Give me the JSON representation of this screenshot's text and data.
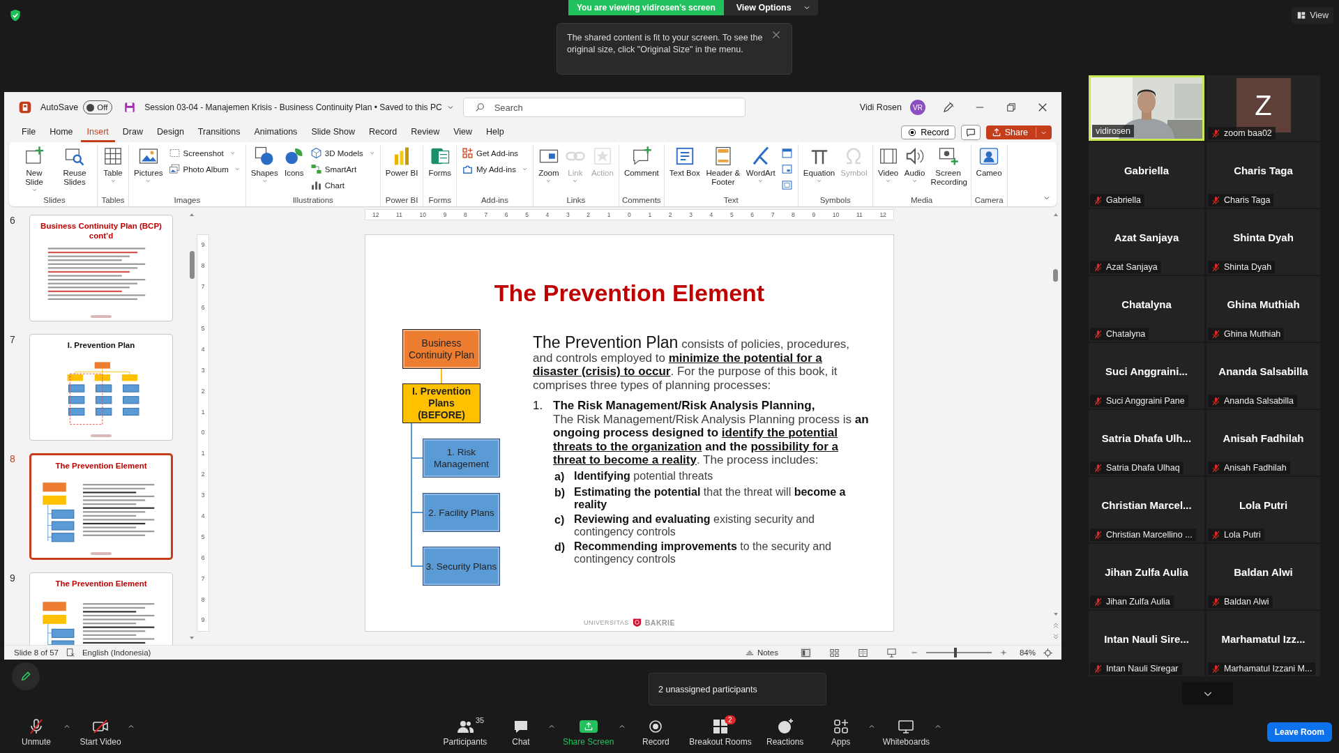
{
  "zoom_top": {
    "banner": "You are viewing vidirosen's screen",
    "view_options": "View Options",
    "notice": "The shared content is fit to your screen. To see the original size, click \"Original Size\" in the menu.",
    "view_button": "View"
  },
  "powerpoint": {
    "title_bar": {
      "autosave_label": "AutoSave",
      "autosave_on": false,
      "autosave_state": "Off",
      "document_title": "Session 03-04 - Manajemen Krisis - Business Continuity Plan • Saved to this PC",
      "search": {
        "placeholder": "Search"
      },
      "user_name": "Vidi Rosen",
      "user_initials": "VR"
    },
    "menu_tabs": [
      {
        "label": "File",
        "selected": false
      },
      {
        "label": "Home",
        "selected": false
      },
      {
        "label": "Insert",
        "selected": true
      },
      {
        "label": "Draw",
        "selected": false
      },
      {
        "label": "Design",
        "selected": false
      },
      {
        "label": "Transitions",
        "selected": false
      },
      {
        "label": "Animations",
        "selected": false
      },
      {
        "label": "Slide Show",
        "selected": false
      },
      {
        "label": "Record",
        "selected": false
      },
      {
        "label": "Review",
        "selected": false
      },
      {
        "label": "View",
        "selected": false
      },
      {
        "label": "Help",
        "selected": false
      }
    ],
    "record_button": "Record",
    "share_button": "Share",
    "ribbon_groups": [
      {
        "label": "Slides",
        "items": [
          {
            "kind": "large",
            "label": "New Slide",
            "dropdown": true,
            "disabled": false
          },
          {
            "kind": "large",
            "label": "Reuse Slides",
            "dropdown": false,
            "disabled": false
          }
        ]
      },
      {
        "label": "Tables",
        "items": [
          {
            "kind": "large",
            "label": "Table",
            "dropdown": true,
            "disabled": false
          }
        ]
      },
      {
        "label": "Images",
        "items": [
          {
            "kind": "large",
            "label": "Pictures",
            "dropdown": true,
            "disabled": false
          },
          {
            "kind": "small",
            "label": "Screenshot",
            "dropdown": true,
            "disabled": false
          },
          {
            "kind": "small",
            "label": "Photo Album",
            "dropdown": true,
            "disabled": false
          }
        ]
      },
      {
        "label": "Illustrations",
        "items": [
          {
            "kind": "large",
            "label": "Shapes",
            "dropdown": true,
            "disabled": false
          },
          {
            "kind": "large",
            "label": "Icons",
            "dropdown": false,
            "disabled": false
          },
          {
            "kind": "small",
            "label": "3D Models",
            "dropdown": true,
            "disabled": false
          },
          {
            "kind": "small",
            "label": "SmartArt",
            "dropdown": false,
            "disabled": false
          },
          {
            "kind": "small",
            "label": "Chart",
            "dropdown": false,
            "disabled": false
          }
        ]
      },
      {
        "label": "Power BI",
        "items": [
          {
            "kind": "large",
            "label": "Power BI",
            "dropdown": false,
            "disabled": false
          }
        ]
      },
      {
        "label": "Forms",
        "items": [
          {
            "kind": "large",
            "label": "Forms",
            "dropdown": false,
            "disabled": false
          }
        ]
      },
      {
        "label": "Add-ins",
        "items": [
          {
            "kind": "small",
            "label": "Get Add-ins",
            "dropdown": false,
            "disabled": false
          },
          {
            "kind": "small",
            "label": "My Add-ins",
            "dropdown": true,
            "disabled": false
          }
        ]
      },
      {
        "label": "Links",
        "items": [
          {
            "kind": "large",
            "label": "Zoom",
            "dropdown": true,
            "disabled": false
          },
          {
            "kind": "large",
            "label": "Link",
            "dropdown": true,
            "disabled": true
          },
          {
            "kind": "large",
            "label": "Action",
            "dropdown": false,
            "disabled": true
          }
        ]
      },
      {
        "label": "Comments",
        "items": [
          {
            "kind": "large",
            "label": "Comment",
            "dropdown": false,
            "disabled": false
          }
        ]
      },
      {
        "label": "Text",
        "items": [
          {
            "kind": "large",
            "label": "Text Box",
            "dropdown": false,
            "disabled": false
          },
          {
            "kind": "large",
            "label": "Header & Footer",
            "dropdown": false,
            "disabled": false
          },
          {
            "kind": "large",
            "label": "WordArt",
            "dropdown": true,
            "disabled": false
          },
          {
            "kind": "icon",
            "dropdown": false,
            "disabled": false
          },
          {
            "kind": "icon",
            "dropdown": false,
            "disabled": false
          },
          {
            "kind": "icon",
            "dropdown": false,
            "disabled": false
          }
        ]
      },
      {
        "label": "Symbols",
        "items": [
          {
            "kind": "large",
            "label": "Equation",
            "dropdown": true,
            "disabled": false
          },
          {
            "kind": "large",
            "label": "Symbol",
            "dropdown": false,
            "disabled": true
          }
        ]
      },
      {
        "label": "Media",
        "items": [
          {
            "kind": "large",
            "label": "Video",
            "dropdown": true,
            "disabled": false
          },
          {
            "kind": "large",
            "label": "Audio",
            "dropdown": true,
            "disabled": false
          },
          {
            "kind": "large",
            "label": "Screen Recording",
            "dropdown": false,
            "disabled": false
          }
        ]
      },
      {
        "label": "Camera",
        "items": [
          {
            "kind": "large",
            "label": "Cameo",
            "dropdown": false,
            "disabled": false
          }
        ]
      }
    ],
    "thumbnails": [
      {
        "number": "6",
        "title": "Business Continuity Plan (BCP) cont’d",
        "color": "#c00000",
        "kind": "text",
        "selected": false
      },
      {
        "number": "7",
        "title": "I. Prevention Plan",
        "color": "#111111",
        "kind": "org-chart",
        "selected": false
      },
      {
        "number": "8",
        "title": "The Prevention Element",
        "color": "#c00000",
        "kind": "diagram-text",
        "selected": true
      },
      {
        "number": "9",
        "title": "The Prevention Element",
        "color": "#c00000",
        "kind": "diagram-text",
        "selected": false
      }
    ],
    "horizontal_ruler": [
      "12",
      "11",
      "10",
      "9",
      "8",
      "7",
      "6",
      "5",
      "4",
      "3",
      "2",
      "1",
      "0",
      "1",
      "2",
      "3",
      "4",
      "5",
      "6",
      "7",
      "8",
      "9",
      "10",
      "11",
      "12"
    ],
    "vertical_ruler": [
      "9",
      "8",
      "7",
      "6",
      "5",
      "4",
      "3",
      "2",
      "1",
      "0",
      "1",
      "2",
      "3",
      "4",
      "5",
      "6",
      "7",
      "8",
      "9"
    ],
    "slide": {
      "title": "The Prevention Element",
      "diagram": [
        {
          "text": "Business Continuity Plan",
          "kind": "root"
        },
        {
          "text": "I. Prevention Plans (BEFORE)",
          "kind": "phase"
        },
        {
          "text": "1. Risk Management",
          "kind": "plan"
        },
        {
          "text": "2. Facility Plans",
          "kind": "plan"
        },
        {
          "text": "3. Security Plans",
          "kind": "plan"
        }
      ],
      "intro": [
        {
          "kind": "lead",
          "text": "The Prevention Plan"
        },
        {
          "kind": "plain",
          "text": " consists of policies, procedures, and controls employed to "
        },
        {
          "kind": "underline",
          "text": "minimize the potential for a disaster (crisis) to occur"
        },
        {
          "kind": "plain",
          "text": ". For the purpose of this book, it comprises three types of planning processes:"
        }
      ],
      "items": [
        {
          "marker": "1.",
          "heading": "The Risk Management/Risk Analysis Planning,",
          "body": [
            {
              "kind": "plain",
              "text": "The Risk Management/Risk Analysis Planning process is "
            },
            {
              "kind": "bold",
              "text": "an ongoing process designed to "
            },
            {
              "kind": "underline",
              "text": "identify the potential threats to the organization"
            },
            {
              "kind": "bold",
              "text": " and the "
            },
            {
              "kind": "underline",
              "text": "possibility for a threat to become a reality"
            },
            {
              "kind": "plain",
              "text": ". The process includes:"
            }
          ],
          "subitems": [
            {
              "marker": "a)",
              "segments": [
                {
                  "kind": "bold",
                  "text": "Identifying"
                },
                {
                  "kind": "plain",
                  "text": " potential threats"
                }
              ]
            },
            {
              "marker": "b)",
              "segments": [
                {
                  "kind": "bold",
                  "text": "Estimating the potential"
                },
                {
                  "kind": "plain",
                  "text": " that the threat will "
                },
                {
                  "kind": "bold",
                  "text": "become a reality"
                }
              ]
            },
            {
              "marker": "c)",
              "segments": [
                {
                  "kind": "bold",
                  "text": "Reviewing and evaluating"
                },
                {
                  "kind": "plain",
                  "text": " existing security and contingency controls"
                }
              ]
            },
            {
              "marker": "d)",
              "segments": [
                {
                  "kind": "bold",
                  "text": "Recommending improvements"
                },
                {
                  "kind": "plain",
                  "text": " to the security and contingency controls"
                }
              ]
            }
          ]
        }
      ],
      "footer": {
        "left": "UNIVERSITAS",
        "right": "BAKRIE"
      }
    },
    "status_bar": {
      "slide_counter": "Slide 8 of 57",
      "language": "English (Indonesia)",
      "notes": "Notes",
      "zoom_slider": {
        "level": 0.45
      },
      "zoom_percent": "84%"
    }
  },
  "gallery": [
    {
      "kind": "video",
      "label": "vidirosen",
      "muted": false,
      "active": true
    },
    {
      "kind": "avatar",
      "initial": "Z",
      "label": "zoom baa02",
      "muted": true,
      "active": false
    },
    {
      "kind": "name",
      "name": "Gabriella",
      "label": "Gabriella",
      "muted": true,
      "active": false
    },
    {
      "kind": "name",
      "name": "Charis Taga",
      "label": "Charis Taga",
      "muted": true,
      "active": false
    },
    {
      "kind": "name",
      "name": "Azat Sanjaya",
      "label": "Azat Sanjaya",
      "muted": true,
      "active": false
    },
    {
      "kind": "name",
      "name": "Shinta Dyah",
      "label": "Shinta Dyah",
      "muted": true,
      "active": false
    },
    {
      "kind": "name",
      "name": "Chatalyna",
      "label": "Chatalyna",
      "muted": true,
      "active": false
    },
    {
      "kind": "name",
      "name": "Ghina Muthiah",
      "label": "Ghina Muthiah",
      "muted": true,
      "active": false
    },
    {
      "kind": "name",
      "name": "Suci Anggraini...",
      "label": "Suci Anggraini Pane",
      "muted": true,
      "active": false
    },
    {
      "kind": "name",
      "name": "Ananda Salsabilla",
      "label": "Ananda Salsabilla",
      "muted": true,
      "active": false
    },
    {
      "kind": "name",
      "name": "Satria Dhafa Ulh...",
      "label": "Satria Dhafa Ulhaq",
      "muted": true,
      "active": false
    },
    {
      "kind": "name",
      "name": "Anisah Fadhilah",
      "label": "Anisah Fadhilah",
      "muted": true,
      "active": false
    },
    {
      "kind": "name",
      "name": "Christian Marcel...",
      "label": "Christian Marcellino ...",
      "muted": true,
      "active": false
    },
    {
      "kind": "name",
      "name": "Lola Putri",
      "label": "Lola Putri",
      "muted": true,
      "active": false
    },
    {
      "kind": "name",
      "name": "Jihan Zulfa Aulia",
      "label": "Jihan Zulfa Aulia",
      "muted": true,
      "active": false
    },
    {
      "kind": "name",
      "name": "Baldan Alwi",
      "label": "Baldan Alwi",
      "muted": true,
      "active": false
    },
    {
      "kind": "name",
      "name": "Intan Nauli Sire...",
      "label": "Intan Nauli Siregar",
      "muted": true,
      "active": false
    },
    {
      "kind": "name",
      "name": "Marhamatul Izz...",
      "label": "Marhamatul Izzani M...",
      "muted": true,
      "active": false
    }
  ],
  "unassigned_tip": "2 unassigned participants",
  "toolbar": {
    "left": [
      {
        "label": "Unmute",
        "kind": "button",
        "caret": true
      },
      {
        "label": "Start Video",
        "kind": "button",
        "caret": true
      }
    ],
    "center": [
      {
        "label": "Participants",
        "kind": "button",
        "caret": false,
        "count": "35"
      },
      {
        "label": "Chat",
        "kind": "button",
        "caret": true
      },
      {
        "label": "Share Screen",
        "kind": "share",
        "caret": true
      },
      {
        "label": "Record",
        "kind": "button",
        "caret": false
      },
      {
        "label": "Breakout Rooms",
        "kind": "button",
        "caret": false,
        "badge": "2"
      },
      {
        "label": "Reactions",
        "kind": "button",
        "caret": false
      },
      {
        "label": "Apps",
        "kind": "button",
        "caret": true
      },
      {
        "label": "Whiteboards",
        "kind": "button",
        "caret": true
      }
    ],
    "leave_button": "Leave Room"
  }
}
